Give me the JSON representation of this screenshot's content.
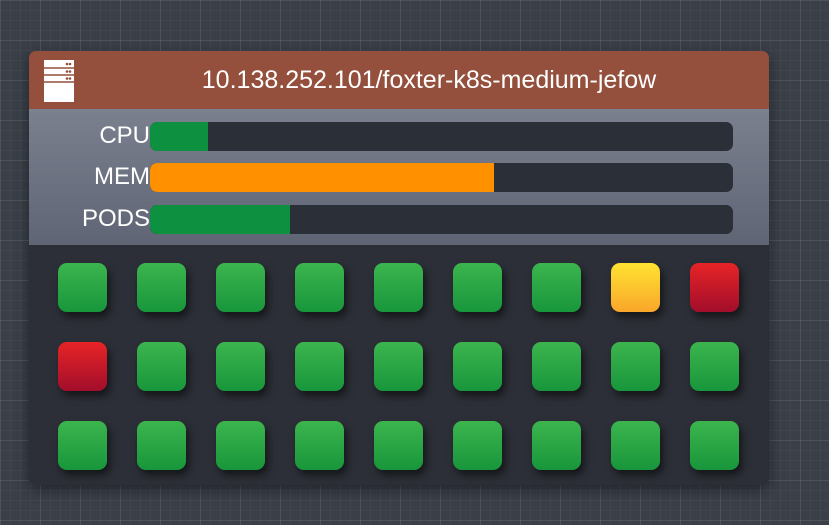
{
  "node": {
    "title": "10.138.252.101/foxter-k8s-medium-jefow",
    "icon": "server-icon",
    "header_color": "#94503d"
  },
  "metrics": [
    {
      "label": "CPU",
      "fraction": 0.1,
      "color": "#0d9040"
    },
    {
      "label": "MEM",
      "fraction": 0.59,
      "color": "#ff9000"
    },
    {
      "label": "PODS",
      "fraction": 0.24,
      "color": "#0d9040"
    }
  ],
  "pods": [
    "ok",
    "ok",
    "ok",
    "ok",
    "ok",
    "ok",
    "ok",
    "warn",
    "err",
    "err",
    "ok",
    "ok",
    "ok",
    "ok",
    "ok",
    "ok",
    "ok",
    "ok",
    "ok",
    "ok",
    "ok",
    "ok",
    "ok",
    "ok",
    "ok",
    "ok",
    "ok"
  ],
  "status_colors": {
    "ok": "#2aa548",
    "warn": "#fdc92e",
    "err": "#c91828"
  }
}
